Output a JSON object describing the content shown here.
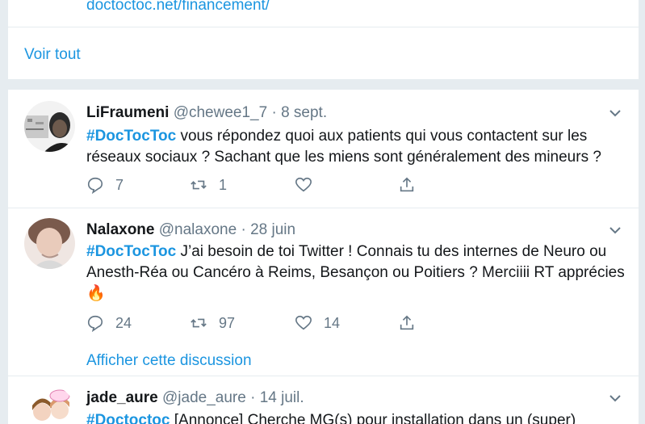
{
  "top": {
    "link_text": "doctoctoc.net/financement/",
    "see_all": "Voir tout"
  },
  "colors": {
    "accent": "#1b95e0",
    "muted": "#657786",
    "separator": "#e6ecf0"
  },
  "tweets": [
    {
      "name": "LiFraumeni",
      "handle": "@chewee1_7",
      "dot": "·",
      "date": "8 sept.",
      "hashtag": "#DocTocToc",
      "text": " vous répondez quoi aux patients qui vous contactent sur les réseaux sociaux ? Sachant que les miens sont généralement des mineurs ?",
      "replies": "7",
      "retweets": "1",
      "likes": ""
    },
    {
      "name": "Nalaxone",
      "handle": "@nalaxone",
      "dot": "·",
      "date": "28 juin",
      "hashtag": "#DocTocToc",
      "text": " J’ai besoin de toi Twitter ! Connais tu des internes de Neuro ou Anesth-Réa ou Cancéro à Reims, Besançon ou Poitiers ? Merciiii RT appréci​es",
      "emoji": "🔥",
      "replies": "24",
      "retweets": "97",
      "likes": "14",
      "thread_link": "Afficher cette discussion"
    },
    {
      "name": "jade_aure",
      "handle": "@jade_aure",
      "dot": "·",
      "date": "14 juil.",
      "hashtag": "#Doctoctoc",
      "text": " [Annonce] Cherche MG(s) pour installation dans un (super)"
    }
  ]
}
